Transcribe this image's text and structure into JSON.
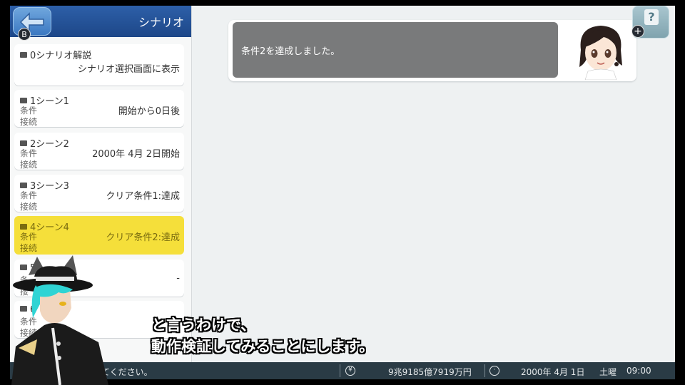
{
  "header": {
    "title": "シナリオ",
    "back_badge": "B"
  },
  "scenes": [
    {
      "title": "0シナリオ解説",
      "rows": [
        {
          "label": "",
          "value": "シナリオ選択画面に表示"
        }
      ]
    },
    {
      "title": "1シーン1",
      "rows": [
        {
          "label": "条件",
          "value": "開始から0日後"
        },
        {
          "label": "接続",
          "value": ""
        }
      ]
    },
    {
      "title": "2シーン2",
      "rows": [
        {
          "label": "条件",
          "value": "2000年 4月 2日開始"
        },
        {
          "label": "接続",
          "value": ""
        }
      ]
    },
    {
      "title": "3シーン3",
      "rows": [
        {
          "label": "条件",
          "value": "クリア条件1:達成"
        },
        {
          "label": "接続",
          "value": ""
        }
      ]
    },
    {
      "title": "4シーン4",
      "selected": true,
      "rows": [
        {
          "label": "条件",
          "value": "クリア条件2:達成"
        },
        {
          "label": "接続",
          "value": ""
        }
      ]
    },
    {
      "title": "5",
      "rows": [
        {
          "label": "条",
          "value": "-"
        },
        {
          "label": "接",
          "value": ""
        }
      ]
    },
    {
      "title": "6",
      "rows": [
        {
          "label": "条件",
          "value": ""
        },
        {
          "label": "接続",
          "value": ""
        }
      ]
    }
  ],
  "message": {
    "text": "条件2を達成しました。"
  },
  "help": {
    "label": "?",
    "plus": "+"
  },
  "status": {
    "hint": "てください。",
    "money": "9兆9185億7919万円",
    "date": "2000年 4月 1日",
    "weekday": "土曜",
    "time": "09:00",
    "currency_icon": "yen-icon",
    "clock_icon": "clock-icon"
  },
  "subtitle": {
    "line1": "と言うわけで、",
    "line2": "動作検証してみることにします。"
  }
}
